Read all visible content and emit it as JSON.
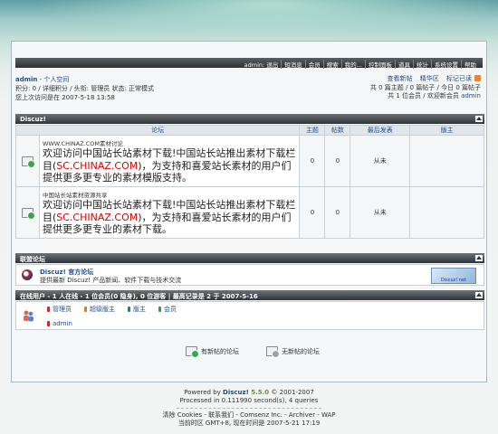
{
  "header": {
    "menu": [
      "admin: 退出",
      "短消息",
      "会员",
      "搜索",
      "我的...",
      "控制面板",
      "道具",
      "统计",
      "系统设置",
      "帮助"
    ]
  },
  "userinfo": {
    "line1_user": "admin",
    "line1_rest": " - 个人空间",
    "line2": "积分: 0 / 详细积分 / 头衔: 管理员 状态: 正常模式",
    "line3": "您上次访问是在 2007-5-18 13:58"
  },
  "stats": {
    "links": [
      "查看新帖",
      "精华区",
      "标记已读"
    ],
    "line2": "共 0 篇主题 / 0 篇帖子 / 今日 0 篇帖子",
    "line3_prefix": "共 1 位会员 / 欢迎新会员 ",
    "line3_user": "admin"
  },
  "category": {
    "title": "Discuz!",
    "columns": [
      "论坛",
      "主题",
      "帖数",
      "最后发表",
      "版主"
    ],
    "forums": [
      {
        "name": "WWW.CHINAZ.COM素材讨论",
        "desc_before": "欢迎访问中国站长站素材下载!中国站长站推出素材下载栏目(",
        "desc_highlight": "SC.CHINAZ.COM",
        "desc_after": ")，为支持和喜爱站长素材的用户们提供更多更专业的素材模版支持。",
        "topics": "0",
        "posts": "0",
        "last": "从未",
        "mods": ""
      },
      {
        "name": "中国站长站素材资源共享",
        "desc_before": "欢迎访问中国站长站素材下载!中国站长站推出素材下载栏目(",
        "desc_highlight": "SC.CHINAZ.COM",
        "desc_after": ")，为支持和喜爱站长素材的用户们提供更多更专业的素材下载。",
        "topics": "0",
        "posts": "0",
        "last": "从未",
        "mods": ""
      }
    ]
  },
  "links": {
    "title": "联盟论坛",
    "name": "Discuz! 官方论坛",
    "desc": "提供最新 Discuz! 产品新闻、软件下载与技术交流",
    "banner_text": "Discuz! net"
  },
  "online": {
    "title": "在线用户 - 1 人在线 - 1 位会员(0 隐身), 0 位游客 | 最高记录是 2 于 2007-5-16",
    "legend": [
      {
        "label": "管理员",
        "color": "#c03030"
      },
      {
        "label": "超级版主",
        "color": "#d08020"
      },
      {
        "label": "版主",
        "color": "#2f6fb0"
      },
      {
        "label": "会员",
        "color": "#3a9a3a"
      }
    ],
    "user": "admin"
  },
  "bottom_legend": {
    "new": "有新帖的论坛",
    "nonew": "无新帖的论坛"
  },
  "footer": {
    "powered": "Powered by ",
    "dz": "Discuz!",
    "ver": " 5.5.0",
    "copy": " © 2001-2007",
    "processed": "Processed in 0.111990 second(s), 4 queries",
    "links": "清除 Cookies - 联系我们 - Comsenz Inc. - Archiver - WAP",
    "time": "当前时区 GMT+8, 现在时间是 2007-5-21 17:19"
  }
}
